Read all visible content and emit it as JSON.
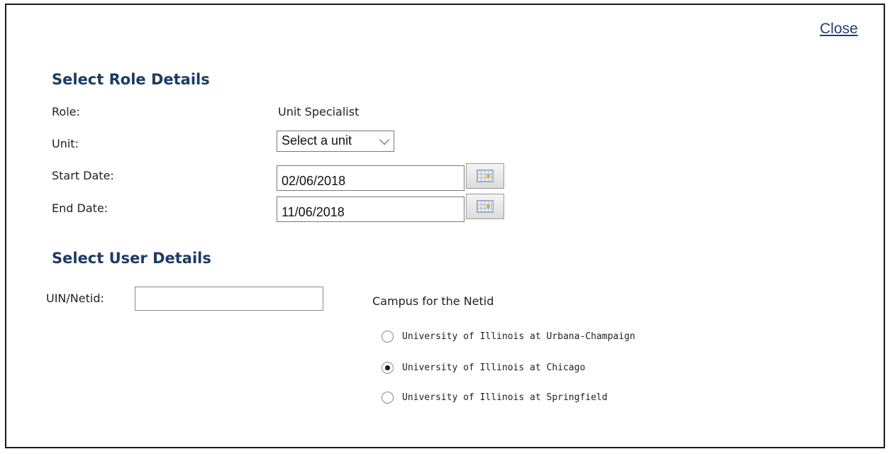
{
  "dialog": {
    "close_label": "Close"
  },
  "role_section": {
    "title": "Select Role Details",
    "role_label": "Role:",
    "role_value": "Unit Specialist",
    "unit_label": "Unit:",
    "unit_select_value": "Select a unit",
    "start_date_label": "Start Date:",
    "start_date_value": "02/06/2018",
    "end_date_label": "End Date:",
    "end_date_value": "11/06/2018"
  },
  "user_section": {
    "title": "Select User Details",
    "uin_label": "UIN/Netid:",
    "uin_value": "",
    "campus_label": "Campus for the Netid",
    "campus_options": [
      {
        "label": "University of Illinois at Urbana-Champaign",
        "checked": false
      },
      {
        "label": "University of Illinois at Chicago",
        "checked": true
      },
      {
        "label": "University of Illinois at Springfield",
        "checked": false
      }
    ]
  },
  "icons": {
    "calendar": "calendar-icon",
    "dropdown": "chevron-down-icon"
  }
}
